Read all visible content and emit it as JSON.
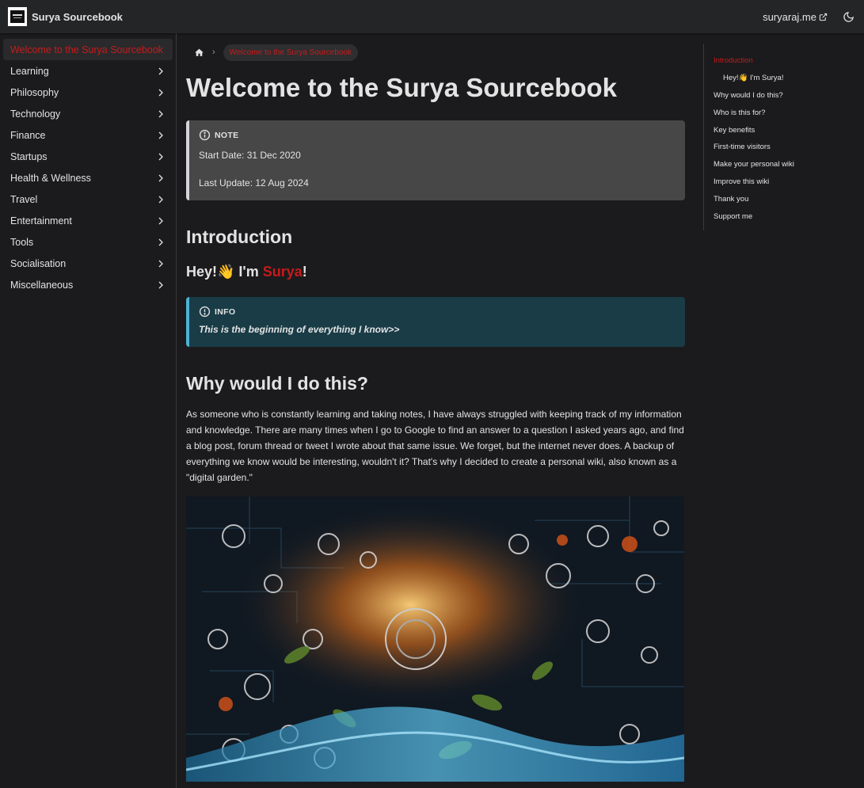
{
  "navbar": {
    "brand_title": "Surya Sourcebook",
    "external_link": "suryaraj.me"
  },
  "sidebar": {
    "items": [
      {
        "label": "Welcome to the Surya Sourcebook",
        "active": true
      },
      {
        "label": "Learning"
      },
      {
        "label": "Philosophy"
      },
      {
        "label": "Technology"
      },
      {
        "label": "Finance"
      },
      {
        "label": "Startups"
      },
      {
        "label": "Health & Wellness"
      },
      {
        "label": "Travel"
      },
      {
        "label": "Entertainment"
      },
      {
        "label": "Tools"
      },
      {
        "label": "Socialisation"
      },
      {
        "label": "Miscellaneous"
      }
    ]
  },
  "breadcrumb": {
    "current": "Welcome to the Surya Sourcebook"
  },
  "main": {
    "title": "Welcome to the Surya Sourcebook",
    "note": {
      "label": "NOTE",
      "start_date": "Start Date: 31 Dec 2020",
      "last_update": "Last Update: 12 Aug 2024"
    },
    "intro_heading": "Introduction",
    "hey_prefix": "Hey!👋 I'm ",
    "hey_name": "Surya",
    "hey_suffix": "!",
    "info": {
      "label": "INFO",
      "text": "This is the beginning of everything I know>>"
    },
    "why_heading": "Why would I do this?",
    "why_paragraph": "As someone who is constantly learning and taking notes, I have always struggled with keeping track of my information and knowledge. There are many times when I go to Google to find an answer to a question I asked years ago, and find a blog post, forum thread or tweet I wrote about that same issue. We forget, but the internet never does. A backup of everything we know would be interesting, wouldn't it? That's why I decided to create a personal wiki, also known as a \"digital garden.\""
  },
  "toc": {
    "items": [
      {
        "label": "Introduction",
        "active": true
      },
      {
        "label": "Hey!👋 I'm Surya!",
        "sub": true
      },
      {
        "label": "Why would I do this?"
      },
      {
        "label": "Who is this for?"
      },
      {
        "label": "Key benefits"
      },
      {
        "label": "First-time visitors"
      },
      {
        "label": "Make your personal wiki"
      },
      {
        "label": "Improve this wiki"
      },
      {
        "label": "Thank you"
      },
      {
        "label": "Support me"
      }
    ]
  },
  "colors": {
    "accent": "#c61b1b",
    "background": "#1b1b1d",
    "navbar": "#242526",
    "note_bg": "#474748",
    "info_bg": "#193c47",
    "info_border": "#4cb3d4"
  }
}
